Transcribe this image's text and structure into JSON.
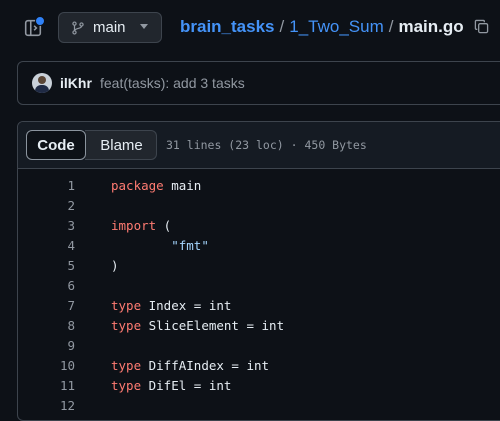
{
  "branch": {
    "name": "main"
  },
  "breadcrumb": {
    "repo": "brain_tasks",
    "sep1": "/",
    "folder": "1_Two_Sum",
    "sep2": "/",
    "file": "main.go"
  },
  "commit": {
    "author": "ilKhr",
    "message": "feat(tasks): add 3 tasks"
  },
  "file_header": {
    "code_tab": "Code",
    "blame_tab": "Blame",
    "meta": "31 lines (23 loc) · 450 Bytes"
  },
  "code_lines": [
    {
      "n": "1",
      "kw": "package",
      "rest": " main",
      "str": ""
    },
    {
      "n": "2",
      "kw": "",
      "rest": "",
      "str": ""
    },
    {
      "n": "3",
      "kw": "import",
      "rest": " (",
      "str": ""
    },
    {
      "n": "4",
      "kw": "",
      "rest": "        ",
      "str": "\"fmt\""
    },
    {
      "n": "5",
      "kw": "",
      "rest": ")",
      "str": ""
    },
    {
      "n": "6",
      "kw": "",
      "rest": "",
      "str": ""
    },
    {
      "n": "7",
      "kw": "type",
      "rest": " Index = int",
      "str": ""
    },
    {
      "n": "8",
      "kw": "type",
      "rest": " SliceElement = int",
      "str": ""
    },
    {
      "n": "9",
      "kw": "",
      "rest": "",
      "str": ""
    },
    {
      "n": "10",
      "kw": "type",
      "rest": " DiffAIndex = int",
      "str": ""
    },
    {
      "n": "11",
      "kw": "type",
      "rest": " DifEl = int",
      "str": ""
    },
    {
      "n": "12",
      "kw": "",
      "rest": "",
      "str": ""
    }
  ],
  "colors": {
    "accent": "#4493f8",
    "keyword": "#ff7b72",
    "string": "#a5d6ff",
    "background": "#0d1117"
  },
  "icons": {
    "sidebar": "sidebar-expand-icon",
    "branch": "git-branch-icon",
    "copy": "copy-icon"
  }
}
